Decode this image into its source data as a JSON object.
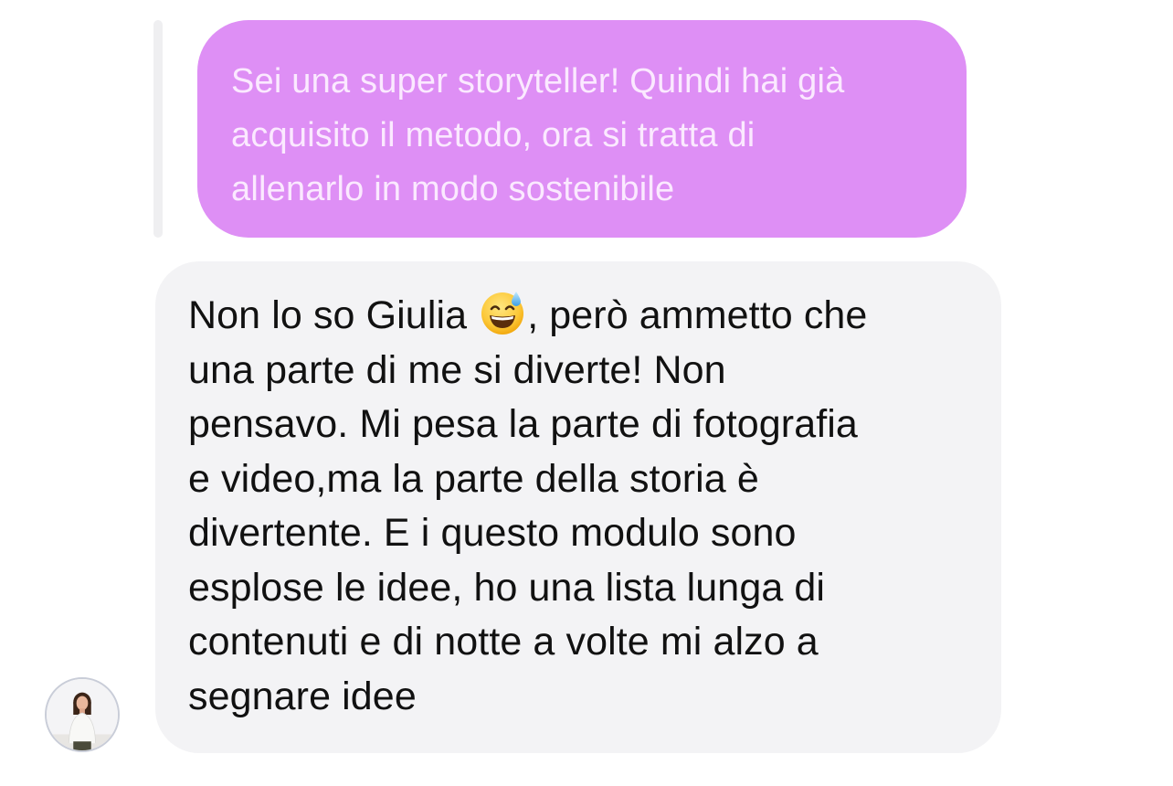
{
  "conversation": {
    "quoted_message": {
      "lines": [
        "Sei una super storyteller! Quindi hai già",
        "acquisito il metodo, ora si tratta di",
        "allenarlo in modo sostenibile"
      ],
      "bubble_color": "#de8ff5",
      "text_color": "#fbe9ff"
    },
    "received_message": {
      "before_emoji": "Non lo so Giulia",
      "emoji": "grinning-face-with-sweat",
      "after_emoji": ", però ammetto che",
      "lines": [
        "una parte di me si diverte! Non",
        "pensavo. Mi pesa la parte di fotografia",
        "e video,ma la parte della storia è",
        "divertente. E i questo modulo sono",
        "esplose le idee, ho una lista lunga di",
        "contenuti e di notte a volte mi alzo a",
        "segnare idee"
      ],
      "bubble_color": "#f3f3f5",
      "text_color": "#111111"
    },
    "sender_avatar": {
      "icon": "user-avatar-photo"
    }
  }
}
